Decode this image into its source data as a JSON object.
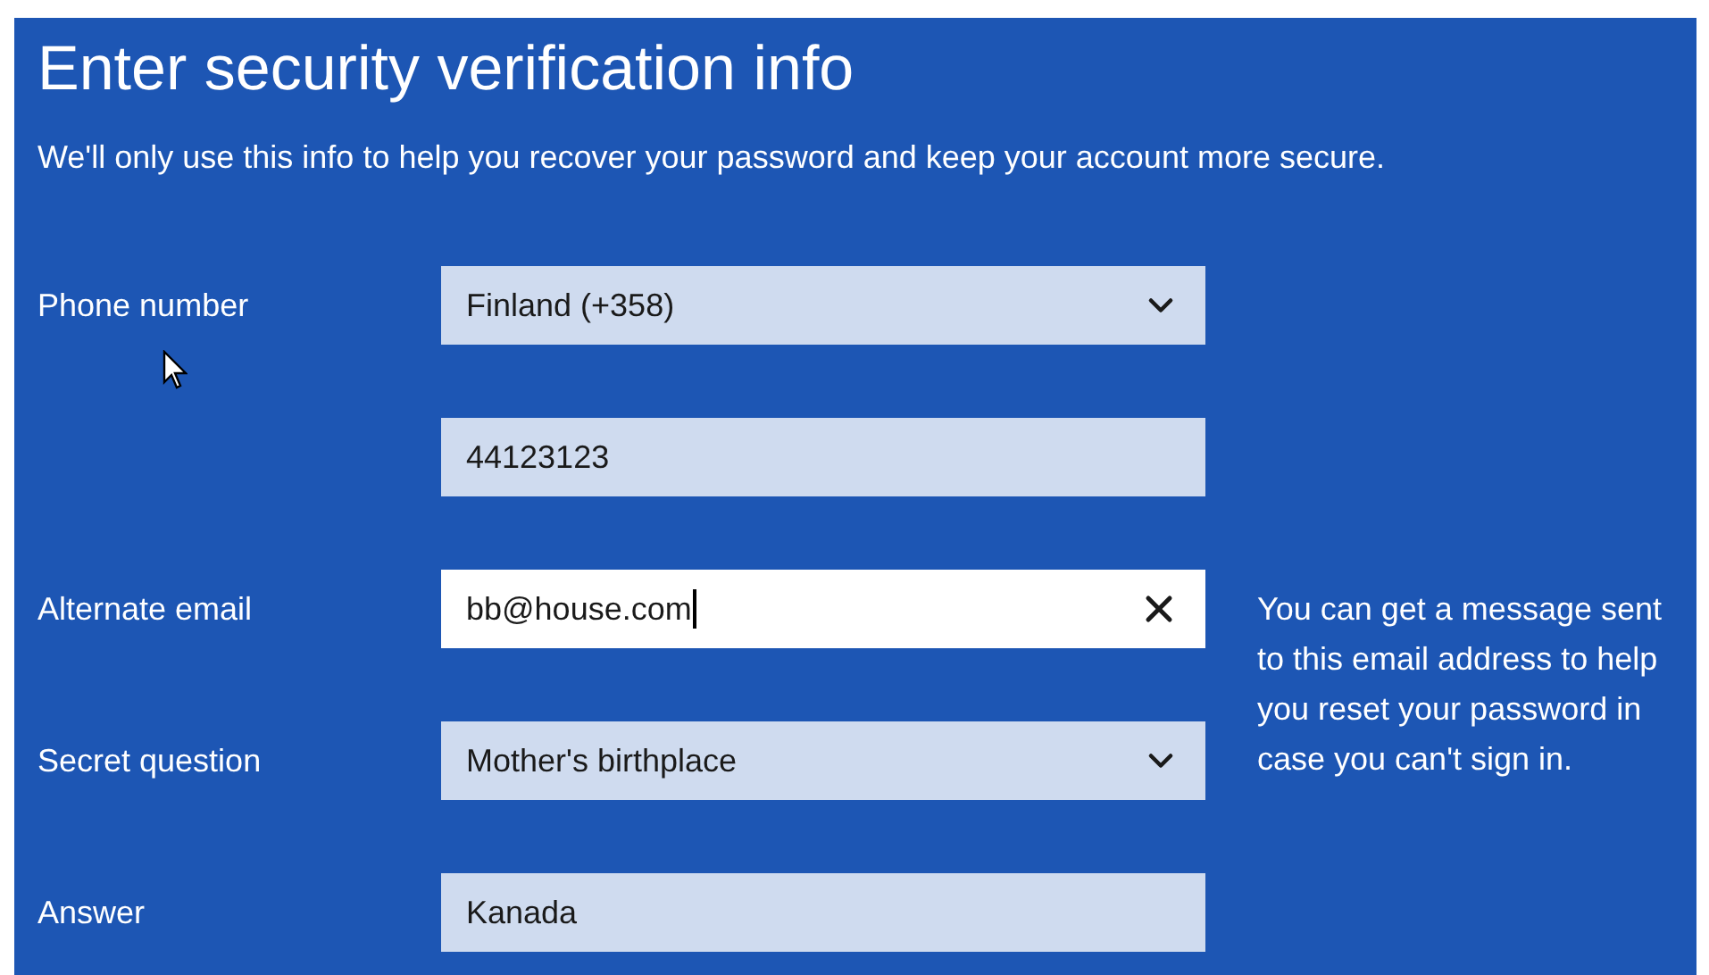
{
  "title": "Enter security verification info",
  "subtitle": "We'll only use this info to help you recover your password and keep your account more secure.",
  "fields": [
    {
      "kind": "select",
      "label": "Phone number",
      "value": "Finland (+358)",
      "focused": false
    },
    {
      "kind": "text",
      "value": "44123123",
      "focused": false
    },
    {
      "kind": "text",
      "label": "Alternate email",
      "value": "bb@house.com",
      "focused": true
    },
    {
      "kind": "select",
      "label": "Secret question",
      "value": "Mother's birthplace",
      "focused": false
    },
    {
      "kind": "text",
      "label": "Answer",
      "value": "Kanada",
      "focused": false
    }
  ],
  "help_text": "You can get a message sent to this email address to help you reset your password in case you can't sign in."
}
